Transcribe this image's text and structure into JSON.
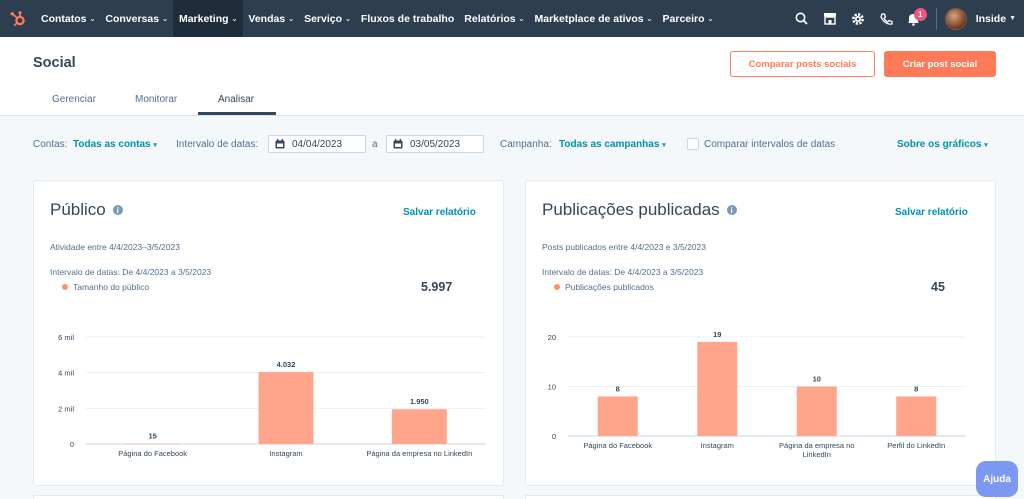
{
  "topnav": {
    "items": [
      {
        "label": "Contatos",
        "active": false
      },
      {
        "label": "Conversas",
        "active": false
      },
      {
        "label": "Marketing",
        "active": true
      },
      {
        "label": "Vendas",
        "active": false
      },
      {
        "label": "Serviço",
        "active": false
      },
      {
        "label": "Fluxos de trabalho",
        "active": false
      },
      {
        "label": "Relatórios",
        "active": false
      },
      {
        "label": "Marketplace de ativos",
        "active": false
      },
      {
        "label": "Parceiro",
        "active": false
      }
    ],
    "notifications_count": "1",
    "account_label": "Inside"
  },
  "header": {
    "title": "Social",
    "compare_button": "Comparar posts sociais",
    "create_button": "Criar post social",
    "tabs": [
      "Gerenciar",
      "Monitorar",
      "Analisar"
    ]
  },
  "filters": {
    "accounts_label": "Contas:",
    "accounts_value": "Todas as contas",
    "date_range_label": "Intervalo de datas:",
    "date_from": "04/04/2023",
    "date_separator": "a",
    "date_to": "03/05/2023",
    "campaign_label": "Campanha:",
    "campaign_value": "Todas as campanhas",
    "compare_ranges_label": "Comparar intervalos de datas",
    "about_charts": "Sobre os gráficos"
  },
  "cards": [
    {
      "title": "Público",
      "save_label": "Salvar relatório",
      "subtitle": "Atividade entre 4/4/2023–3/5/2023",
      "range_text": "Intervalo de datas: De 4/4/2023 a 3/5/2023",
      "legend": "Tamanho do público",
      "total": "5.997"
    },
    {
      "title": "Publicações publicadas",
      "save_label": "Salvar relatório",
      "subtitle": "Posts publicados entre 4/4/2023 e 3/5/2023",
      "range_text": "Intervalo de datas: De 4/4/2023 a 3/5/2023",
      "legend": "Publicações publicados",
      "total": "45"
    }
  ],
  "chart_data": [
    {
      "type": "bar",
      "categories": [
        "Página do Facebook",
        "Instagram",
        "Página da empresa no LinkedIn"
      ],
      "values": [
        15,
        4032,
        1950
      ],
      "value_labels": [
        "15",
        "4.032",
        "1.950"
      ],
      "yticks": [
        0,
        2000,
        4000,
        6000
      ],
      "ytick_labels": [
        "0",
        "2 mil",
        "4 mil",
        "6 mil"
      ],
      "ylim": [
        0,
        6000
      ],
      "series": [
        {
          "name": "Tamanho do público",
          "values": [
            15,
            4032,
            1950
          ]
        }
      ],
      "color": "#ffa58c",
      "grid": true
    },
    {
      "type": "bar",
      "categories": [
        "Página do Facebook",
        "Instagram",
        "Página da empresa no LinkedIn",
        "Perfil do LinkedIn"
      ],
      "values": [
        8,
        19,
        10,
        8
      ],
      "value_labels": [
        "8",
        "19",
        "10",
        "8"
      ],
      "yticks": [
        0,
        10,
        20
      ],
      "ytick_labels": [
        "0",
        "10",
        "20"
      ],
      "ylim": [
        0,
        20
      ],
      "series": [
        {
          "name": "Publicações publicados",
          "values": [
            8,
            19,
            10,
            8
          ]
        }
      ],
      "color": "#ffa58c",
      "grid": true
    }
  ],
  "help_label": "Ajuda",
  "colors": {
    "nav_bg": "#2d3e50",
    "accent": "#ff7a59",
    "link": "#0091ae",
    "bar": "#ffa58c"
  }
}
